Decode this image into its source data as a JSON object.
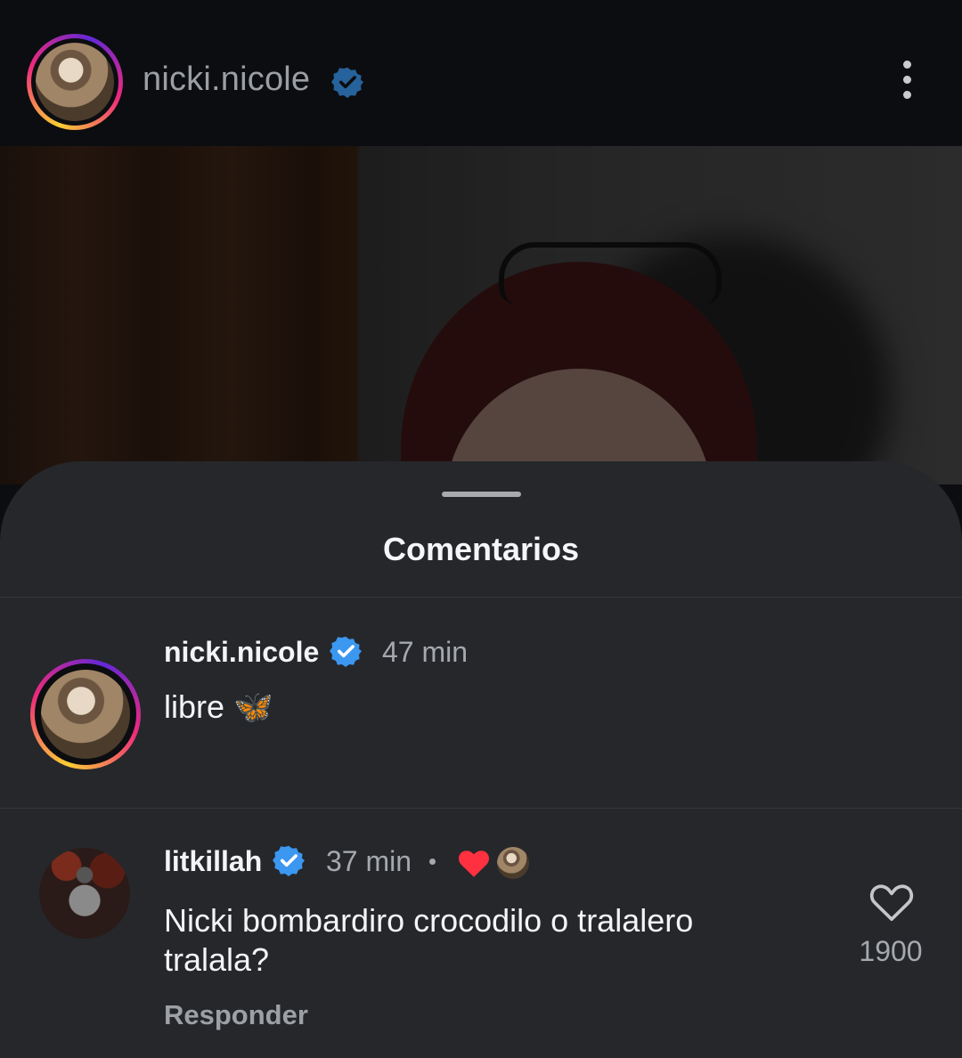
{
  "header": {
    "username": "nicki.nicole",
    "verified": true,
    "icons": [
      "story-ring-avatar",
      "verified-badge-icon",
      "more-options-icon"
    ]
  },
  "sheet": {
    "title": "Comentarios"
  },
  "comments": [
    {
      "username": "nicki.nicole",
      "verified": true,
      "time": "47 min",
      "text": "libre 🦋",
      "emoji": "butterfly-icon",
      "has_story_ring": true
    },
    {
      "username": "litkillah",
      "verified": true,
      "time": "37 min",
      "separator": "•",
      "liked_by_author": true,
      "text": "Nicki bombardiro crocodilo o tralalero tralala?",
      "reply_label": "Responder",
      "like_count": "1900"
    }
  ],
  "colors": {
    "background": "#0c0d10",
    "sheet": "#25272b",
    "verified_blue": "#3b97f0",
    "liked_red": "#ff3040",
    "secondary_text": "#a5a8ad"
  }
}
